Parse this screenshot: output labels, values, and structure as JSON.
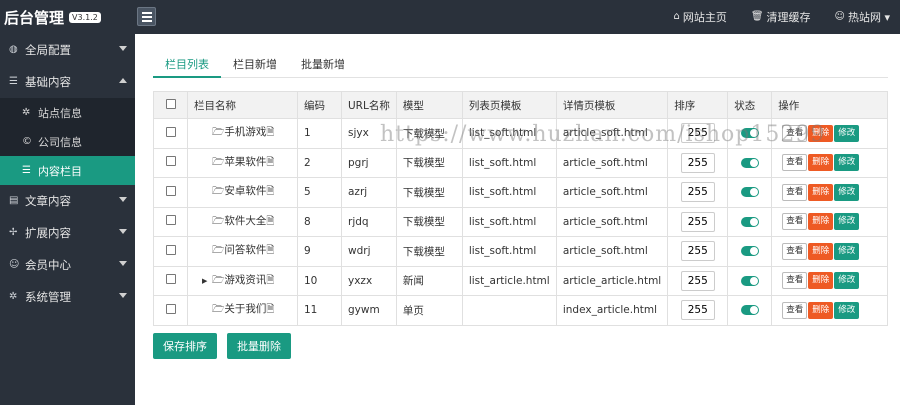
{
  "brand": {
    "title": "后台管理",
    "version": "V3.1.2"
  },
  "topbar": {
    "links": [
      {
        "icon": "home-icon",
        "glyph": "⌂",
        "label": "网站主页"
      },
      {
        "icon": "trash-icon",
        "glyph": "🗑",
        "label": "清理缓存"
      },
      {
        "icon": "user-icon",
        "glyph": "☺",
        "label": "热站网 ▾"
      }
    ]
  },
  "sidebar": {
    "items": [
      {
        "icon": "globe-icon",
        "glyph": "◍",
        "label": "全局配置",
        "expanded": false
      },
      {
        "icon": "sliders-icon",
        "glyph": "☰",
        "label": "基础内容",
        "expanded": true,
        "children": [
          {
            "icon": "gear-icon",
            "glyph": "✲",
            "label": "站点信息"
          },
          {
            "icon": "copyright-icon",
            "glyph": "©",
            "label": "公司信息"
          },
          {
            "icon": "list-icon",
            "glyph": "☰",
            "label": "内容栏目",
            "active": true
          }
        ]
      },
      {
        "icon": "file-icon",
        "glyph": "▤",
        "label": "文章内容",
        "expanded": false
      },
      {
        "icon": "expand-icon",
        "glyph": "✢",
        "label": "扩展内容",
        "expanded": false
      },
      {
        "icon": "user-icon",
        "glyph": "☺",
        "label": "会员中心",
        "expanded": false
      },
      {
        "icon": "gear-icon",
        "glyph": "✲",
        "label": "系统管理",
        "expanded": false
      }
    ]
  },
  "tabs": [
    {
      "label": "栏目列表",
      "active": true
    },
    {
      "label": "栏目新增",
      "active": false
    },
    {
      "label": "批量新增",
      "active": false
    }
  ],
  "table": {
    "headers": [
      "栏目名称",
      "编码",
      "URL名称",
      "模型",
      "列表页模板",
      "详情页模板",
      "排序",
      "状态",
      "操作"
    ],
    "rows": [
      {
        "name": "手机游戏",
        "code": "1",
        "url": "sjyx",
        "model": "下载模型",
        "list_tpl": "list_soft.html",
        "detail_tpl": "article_soft.html",
        "sort": "255",
        "expandable": false
      },
      {
        "name": "苹果软件",
        "code": "2",
        "url": "pgrj",
        "model": "下载模型",
        "list_tpl": "list_soft.html",
        "detail_tpl": "article_soft.html",
        "sort": "255",
        "expandable": false
      },
      {
        "name": "安卓软件",
        "code": "5",
        "url": "azrj",
        "model": "下载模型",
        "list_tpl": "list_soft.html",
        "detail_tpl": "article_soft.html",
        "sort": "255",
        "expandable": false
      },
      {
        "name": "软件大全",
        "code": "8",
        "url": "rjdq",
        "model": "下载模型",
        "list_tpl": "list_soft.html",
        "detail_tpl": "article_soft.html",
        "sort": "255",
        "expandable": false
      },
      {
        "name": "问答软件",
        "code": "9",
        "url": "wdrj",
        "model": "下载模型",
        "list_tpl": "list_soft.html",
        "detail_tpl": "article_soft.html",
        "sort": "255",
        "expandable": false
      },
      {
        "name": "游戏资讯",
        "code": "10",
        "url": "yxzx",
        "model": "新闻",
        "list_tpl": "list_article.html",
        "detail_tpl": "article_article.html",
        "sort": "255",
        "expandable": true
      },
      {
        "name": "关于我们",
        "code": "11",
        "url": "gywm",
        "model": "单页",
        "list_tpl": "",
        "detail_tpl": "index_article.html",
        "sort": "255",
        "expandable": false
      }
    ],
    "actions": {
      "view": "查看",
      "delete": "删除",
      "edit": "修改"
    }
  },
  "buttons": {
    "save_sort": "保存排序",
    "bulk_delete": "批量删除"
  },
  "watermark": "https://www.huzhan.com/ishop15299",
  "colors": {
    "accent": "#1a9a82",
    "danger": "#ee5a24",
    "dark": "#2a313b"
  }
}
